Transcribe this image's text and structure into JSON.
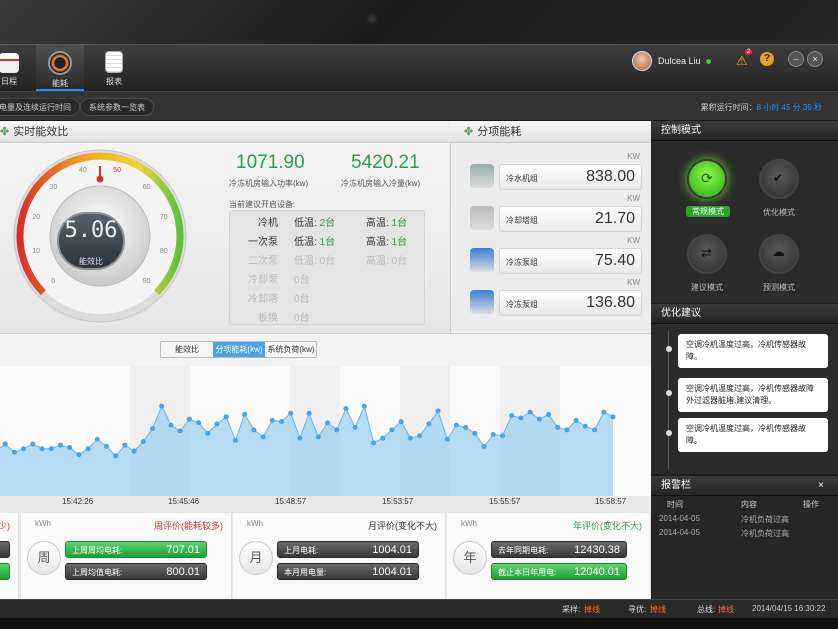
{
  "nav": {
    "items": [
      {
        "label": "日程"
      },
      {
        "label": "能耗"
      },
      {
        "label": "报表"
      }
    ],
    "user": "Dulcea Liu",
    "alert_count": "2"
  },
  "subbar": {
    "pill1": "电量及连续运行时间",
    "pill2": "系统参数一览表",
    "runtime_label": "累积运行时间：",
    "runtime_value": "8 小时 45 分 39 秒"
  },
  "realtime": {
    "title": "实时能效比",
    "cop_value": "5.06",
    "cop_label": "能效比",
    "gauge_ticks": [
      "0",
      "10",
      "20",
      "30",
      "40",
      "50",
      "60",
      "70",
      "80",
      "90"
    ],
    "power_in": "1071.90",
    "power_in_label": "冷冻机房输入功率(kw)",
    "cooling_in": "5420.21",
    "cooling_in_label": "冷冻机房输入冷量(kw)",
    "advice_label": "当前建议开启设备:",
    "equipment": [
      {
        "name": "冷机",
        "low": "低温: ",
        "low_n": "2台",
        "high": "高温: ",
        "high_n": "1台",
        "active": true
      },
      {
        "name": "一次泵",
        "low": "低温: ",
        "low_n": "1台",
        "high": "高温: ",
        "high_n": "1台",
        "active": true
      },
      {
        "name": "二次泵",
        "low": "低温: ",
        "low_n": "0台",
        "high": "高温: ",
        "high_n": "0台",
        "active": false
      },
      {
        "name": "冷却泵",
        "low": "",
        "low_n": "0台",
        "high": "",
        "high_n": "",
        "active": false
      },
      {
        "name": "冷却塔",
        "low": "",
        "low_n": "0台",
        "high": "",
        "high_n": "",
        "active": false
      },
      {
        "name": "板换",
        "low": "",
        "low_n": "0台",
        "high": "",
        "high_n": "",
        "active": false
      }
    ]
  },
  "subitem": {
    "title": "分项能耗",
    "unit": "KW",
    "rows": [
      {
        "name": "冷水机组",
        "value": "838.00"
      },
      {
        "name": "冷却塔组",
        "value": "21.70"
      },
      {
        "name": "冷冻泵组",
        "value": "75.40"
      },
      {
        "name": "冷冻泵组",
        "value": "136.80"
      }
    ]
  },
  "chart_tabs": [
    "能效比",
    "分项能耗(kw)",
    "系统负荷(kw)"
  ],
  "chart_data": {
    "type": "area",
    "x": [
      "15:42:26",
      "15:45:46",
      "15:48:57",
      "15:53:57",
      "15:55:57",
      "15:58:57"
    ],
    "values": [
      38,
      44,
      37,
      40,
      44,
      40,
      40,
      43,
      41,
      35,
      40,
      48,
      42,
      34,
      43,
      38,
      46,
      57,
      76,
      60,
      55,
      65,
      62,
      53,
      61,
      67,
      47,
      69,
      56,
      50,
      64,
      63,
      70,
      49,
      70,
      50,
      62,
      56,
      74,
      58,
      76,
      45,
      49,
      56,
      63,
      49,
      51,
      61,
      72,
      48,
      60,
      58,
      53,
      42,
      52,
      51,
      68,
      66,
      71,
      65,
      69,
      58,
      56,
      64,
      59,
      56,
      71,
      67
    ],
    "ylim": [
      0,
      110
    ],
    "color": "#9fd0f2"
  },
  "stats": [
    {
      "unit": "kWh",
      "title": "少)",
      "rows": [
        {
          "label": "",
          "value": ""
        },
        {
          "label": "",
          "value": ""
        }
      ]
    },
    {
      "unit": "kWh",
      "title": "周评价(能耗较多)",
      "circle": "周",
      "rows": [
        {
          "label": "上周周均电耗:",
          "value": "707.01"
        },
        {
          "label": "上周均值电耗:",
          "value": "800.01"
        }
      ]
    },
    {
      "unit": "kWh",
      "title": "月评价(变化不大)",
      "circle": "月",
      "rows": [
        {
          "label": "上月电耗:",
          "value": "1004.01"
        },
        {
          "label": "本月用电量:",
          "value": "1004.01"
        }
      ]
    },
    {
      "unit": "kWh",
      "title": "年评价(变化不大)",
      "circle": "年",
      "rows": [
        {
          "label": "去年同期电耗:",
          "value": "12430.38"
        },
        {
          "label": "截止本日年用电:",
          "value": "12040.01"
        }
      ]
    }
  ],
  "control": {
    "title": "控制模式",
    "modes": [
      "常规模式",
      "优化模式",
      "建议模式",
      "预测模式"
    ]
  },
  "optimize": {
    "title": "优化建议",
    "items": [
      "空调冷机温度过高，冷机传感器故障。",
      "空调冷机温度过高，冷机传感器故障外过滤器脏堵,建议清理。",
      "空调冷机温度过高，冷机传感器故障。"
    ]
  },
  "alarm": {
    "title": "报警栏",
    "close": "×",
    "headers": [
      "时间",
      "内容",
      "操作"
    ],
    "rows": [
      {
        "time": "2014-04-05",
        "content": "冷机负荷过高"
      },
      {
        "time": "2014-04-05",
        "content": "冷机负荷过高"
      }
    ]
  },
  "status": {
    "l1": "采样:",
    "v1": "掉线",
    "l2": "寻优:",
    "v2": "掉线",
    "l3": "总线:",
    "v3": "掉线",
    "datetime": "2014/04/15   16:30:22"
  }
}
